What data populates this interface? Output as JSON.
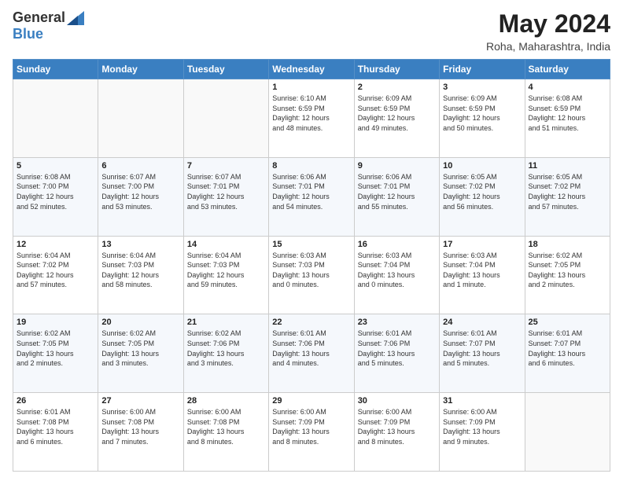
{
  "header": {
    "logo_general": "General",
    "logo_blue": "Blue",
    "month_year": "May 2024",
    "location": "Roha, Maharashtra, India"
  },
  "days_of_week": [
    "Sunday",
    "Monday",
    "Tuesday",
    "Wednesday",
    "Thursday",
    "Friday",
    "Saturday"
  ],
  "weeks": [
    [
      {
        "day": "",
        "info": ""
      },
      {
        "day": "",
        "info": ""
      },
      {
        "day": "",
        "info": ""
      },
      {
        "day": "1",
        "info": "Sunrise: 6:10 AM\nSunset: 6:59 PM\nDaylight: 12 hours\nand 48 minutes."
      },
      {
        "day": "2",
        "info": "Sunrise: 6:09 AM\nSunset: 6:59 PM\nDaylight: 12 hours\nand 49 minutes."
      },
      {
        "day": "3",
        "info": "Sunrise: 6:09 AM\nSunset: 6:59 PM\nDaylight: 12 hours\nand 50 minutes."
      },
      {
        "day": "4",
        "info": "Sunrise: 6:08 AM\nSunset: 6:59 PM\nDaylight: 12 hours\nand 51 minutes."
      }
    ],
    [
      {
        "day": "5",
        "info": "Sunrise: 6:08 AM\nSunset: 7:00 PM\nDaylight: 12 hours\nand 52 minutes."
      },
      {
        "day": "6",
        "info": "Sunrise: 6:07 AM\nSunset: 7:00 PM\nDaylight: 12 hours\nand 53 minutes."
      },
      {
        "day": "7",
        "info": "Sunrise: 6:07 AM\nSunset: 7:01 PM\nDaylight: 12 hours\nand 53 minutes."
      },
      {
        "day": "8",
        "info": "Sunrise: 6:06 AM\nSunset: 7:01 PM\nDaylight: 12 hours\nand 54 minutes."
      },
      {
        "day": "9",
        "info": "Sunrise: 6:06 AM\nSunset: 7:01 PM\nDaylight: 12 hours\nand 55 minutes."
      },
      {
        "day": "10",
        "info": "Sunrise: 6:05 AM\nSunset: 7:02 PM\nDaylight: 12 hours\nand 56 minutes."
      },
      {
        "day": "11",
        "info": "Sunrise: 6:05 AM\nSunset: 7:02 PM\nDaylight: 12 hours\nand 57 minutes."
      }
    ],
    [
      {
        "day": "12",
        "info": "Sunrise: 6:04 AM\nSunset: 7:02 PM\nDaylight: 12 hours\nand 57 minutes."
      },
      {
        "day": "13",
        "info": "Sunrise: 6:04 AM\nSunset: 7:03 PM\nDaylight: 12 hours\nand 58 minutes."
      },
      {
        "day": "14",
        "info": "Sunrise: 6:04 AM\nSunset: 7:03 PM\nDaylight: 12 hours\nand 59 minutes."
      },
      {
        "day": "15",
        "info": "Sunrise: 6:03 AM\nSunset: 7:03 PM\nDaylight: 13 hours\nand 0 minutes."
      },
      {
        "day": "16",
        "info": "Sunrise: 6:03 AM\nSunset: 7:04 PM\nDaylight: 13 hours\nand 0 minutes."
      },
      {
        "day": "17",
        "info": "Sunrise: 6:03 AM\nSunset: 7:04 PM\nDaylight: 13 hours\nand 1 minute."
      },
      {
        "day": "18",
        "info": "Sunrise: 6:02 AM\nSunset: 7:05 PM\nDaylight: 13 hours\nand 2 minutes."
      }
    ],
    [
      {
        "day": "19",
        "info": "Sunrise: 6:02 AM\nSunset: 7:05 PM\nDaylight: 13 hours\nand 2 minutes."
      },
      {
        "day": "20",
        "info": "Sunrise: 6:02 AM\nSunset: 7:05 PM\nDaylight: 13 hours\nand 3 minutes."
      },
      {
        "day": "21",
        "info": "Sunrise: 6:02 AM\nSunset: 7:06 PM\nDaylight: 13 hours\nand 3 minutes."
      },
      {
        "day": "22",
        "info": "Sunrise: 6:01 AM\nSunset: 7:06 PM\nDaylight: 13 hours\nand 4 minutes."
      },
      {
        "day": "23",
        "info": "Sunrise: 6:01 AM\nSunset: 7:06 PM\nDaylight: 13 hours\nand 5 minutes."
      },
      {
        "day": "24",
        "info": "Sunrise: 6:01 AM\nSunset: 7:07 PM\nDaylight: 13 hours\nand 5 minutes."
      },
      {
        "day": "25",
        "info": "Sunrise: 6:01 AM\nSunset: 7:07 PM\nDaylight: 13 hours\nand 6 minutes."
      }
    ],
    [
      {
        "day": "26",
        "info": "Sunrise: 6:01 AM\nSunset: 7:08 PM\nDaylight: 13 hours\nand 6 minutes."
      },
      {
        "day": "27",
        "info": "Sunrise: 6:00 AM\nSunset: 7:08 PM\nDaylight: 13 hours\nand 7 minutes."
      },
      {
        "day": "28",
        "info": "Sunrise: 6:00 AM\nSunset: 7:08 PM\nDaylight: 13 hours\nand 8 minutes."
      },
      {
        "day": "29",
        "info": "Sunrise: 6:00 AM\nSunset: 7:09 PM\nDaylight: 13 hours\nand 8 minutes."
      },
      {
        "day": "30",
        "info": "Sunrise: 6:00 AM\nSunset: 7:09 PM\nDaylight: 13 hours\nand 8 minutes."
      },
      {
        "day": "31",
        "info": "Sunrise: 6:00 AM\nSunset: 7:09 PM\nDaylight: 13 hours\nand 9 minutes."
      },
      {
        "day": "",
        "info": ""
      }
    ]
  ]
}
